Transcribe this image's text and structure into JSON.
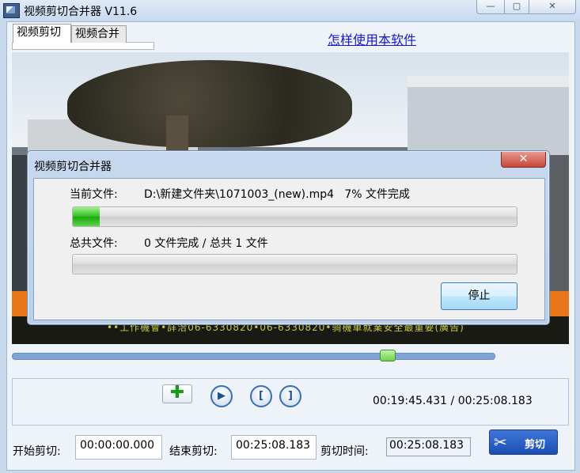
{
  "window": {
    "title": "视频剪切合并器 V11.6",
    "minimize_glyph": "—",
    "maximize_glyph": "▢",
    "close_glyph": "✕"
  },
  "tabs": [
    {
      "label": "视频剪切",
      "active": true
    },
    {
      "label": "视频合并",
      "active": false
    }
  ],
  "help_link": "怎样使用本软件",
  "video": {
    "ticker_text": "••工作機會•詳洽06-6330820•06-6330820•骑機車就業安全最重要(廣告)"
  },
  "seek": {
    "position": 0.778
  },
  "controls": {
    "add_glyph": "✚",
    "play_glyph": "▶",
    "mark_in_glyph": "[",
    "mark_out_glyph": "]",
    "current_time": "00:19:45.431",
    "time_separator": "/",
    "total_time": "00:25:08.183"
  },
  "cut_settings": {
    "start_label": "开始剪切:",
    "start_value": "00:00:00.000",
    "end_label": "结束剪切:",
    "end_value": "00:25:08.183",
    "duration_label": "剪切时间:",
    "duration_value": "00:25:08.183",
    "cut_button_label": "剪切",
    "cut_icon": "scissors-icon"
  },
  "dialog": {
    "title": "视频剪切合并器",
    "close_glyph": "✕",
    "current_file_label": "当前文件:",
    "current_file_value": "D:\\新建文件夹\\1071003_(new).mp4   7% 文件完成",
    "current_progress": 0.06,
    "total_label": "总共文件:",
    "total_value": "0 文件完成 / 总共 1 文件",
    "total_progress": 0,
    "stop_label": "停止"
  },
  "colors": {
    "accent": "#1c4fb4",
    "progress_green": "#2fbd1e",
    "link": "#1818c8"
  }
}
